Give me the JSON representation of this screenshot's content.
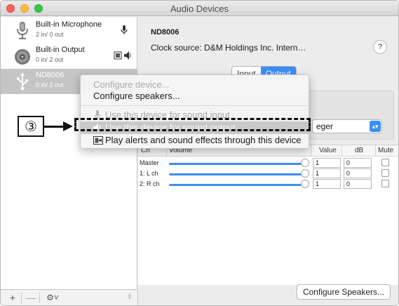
{
  "window": {
    "title": "Audio Devices"
  },
  "sidebar": {
    "devices": [
      {
        "name": "Built-in Microphone",
        "io": "2 in/ 0 out",
        "icon": "microphone-icon",
        "badge": "🎙"
      },
      {
        "name": "Built-in Output",
        "io": "0 in/ 2 out",
        "icon": "speaker-icon",
        "badge": "▣🔈"
      },
      {
        "name": "ND8006",
        "io": "0 in/ 2 out",
        "icon": "usb-icon",
        "selected": true
      }
    ],
    "bottom": {
      "add": "+",
      "remove": "—",
      "gear": "⚙˅",
      "grip": "‖"
    }
  },
  "main": {
    "device_title": "ND8006",
    "clock_source": "Clock source:  D&M Holdings Inc. Intern…",
    "help": "?",
    "tabs": [
      {
        "label": "Input",
        "active": false
      },
      {
        "label": "Output",
        "active": true
      }
    ],
    "format_value": "eger",
    "table": {
      "headers": {
        "ch": "Ch",
        "volume": "Volume",
        "value": "Value",
        "db": "dB",
        "mute": "Mute"
      },
      "rows": [
        {
          "ch": "Master",
          "value": "1",
          "db": "0",
          "muted": false,
          "level": 1.0
        },
        {
          "ch": "1: L ch",
          "value": "1",
          "db": "0",
          "muted": false,
          "level": 1.0
        },
        {
          "ch": "2: R ch",
          "value": "1",
          "db": "0",
          "muted": false,
          "level": 1.0
        }
      ]
    },
    "configure_button": "Configure Speakers..."
  },
  "context_menu": {
    "items": [
      {
        "label": "Configure device...",
        "disabled": true
      },
      {
        "label": "Configure speakers...",
        "disabled": false
      },
      {
        "label": "Use this device for sound input",
        "disabled": true,
        "icon": "microphone-icon"
      },
      {
        "label": "Use this device for sound output",
        "highlighted": true,
        "icon": "speaker-icon"
      },
      {
        "label": "Play alerts and sound effects through this device",
        "disabled": false,
        "icon": "alert-speaker-icon"
      }
    ]
  },
  "callout": {
    "number": "③"
  },
  "colors": {
    "accent": "#3c8ef4",
    "selection": "#c5c5c5"
  }
}
